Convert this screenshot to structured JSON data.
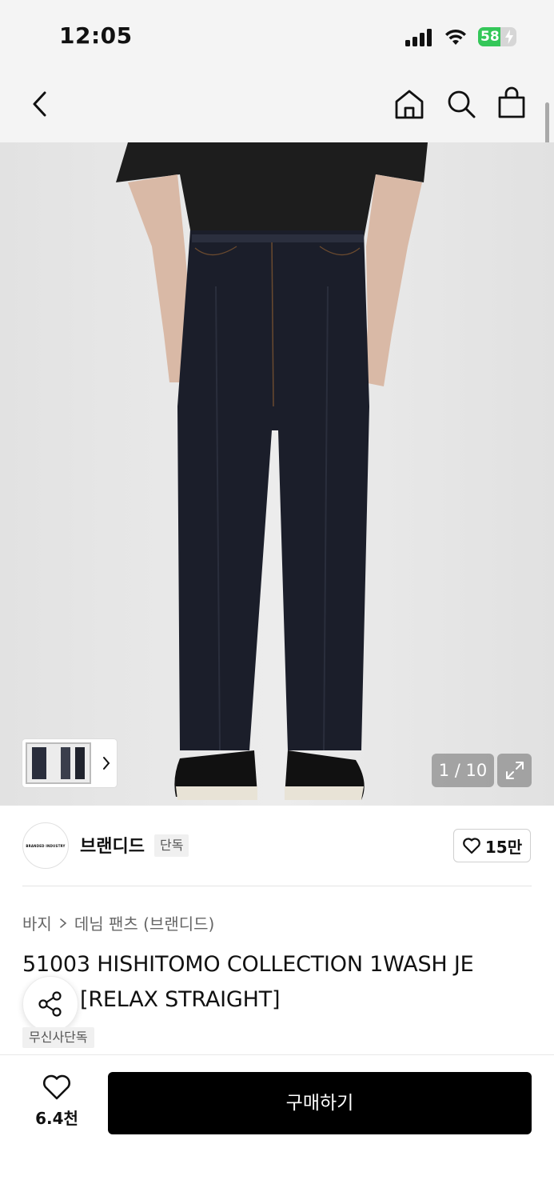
{
  "status_bar": {
    "time": "12:05",
    "battery_level": "58",
    "battery_fraction": 0.58
  },
  "gallery": {
    "counter": "1 / 10"
  },
  "brand": {
    "logo_text": "BRANDED INDUSTRY",
    "name": "브랜디드",
    "badge": "단독",
    "like_count": "15만"
  },
  "breadcrumb": {
    "category": "바지",
    "subcategory": "데님 팬츠 (브랜디드)"
  },
  "product": {
    "title_line1": "51003 HISHITOMO COLLECTION 1WASH JE",
    "title_line2": "[RELAX STRAIGHT]",
    "tag": "무신사단독"
  },
  "bottom_bar": {
    "wish_count": "6.4천",
    "buy_label": "구매하기"
  },
  "colors": {
    "accent": "#000000",
    "battery_green": "#34c759"
  }
}
